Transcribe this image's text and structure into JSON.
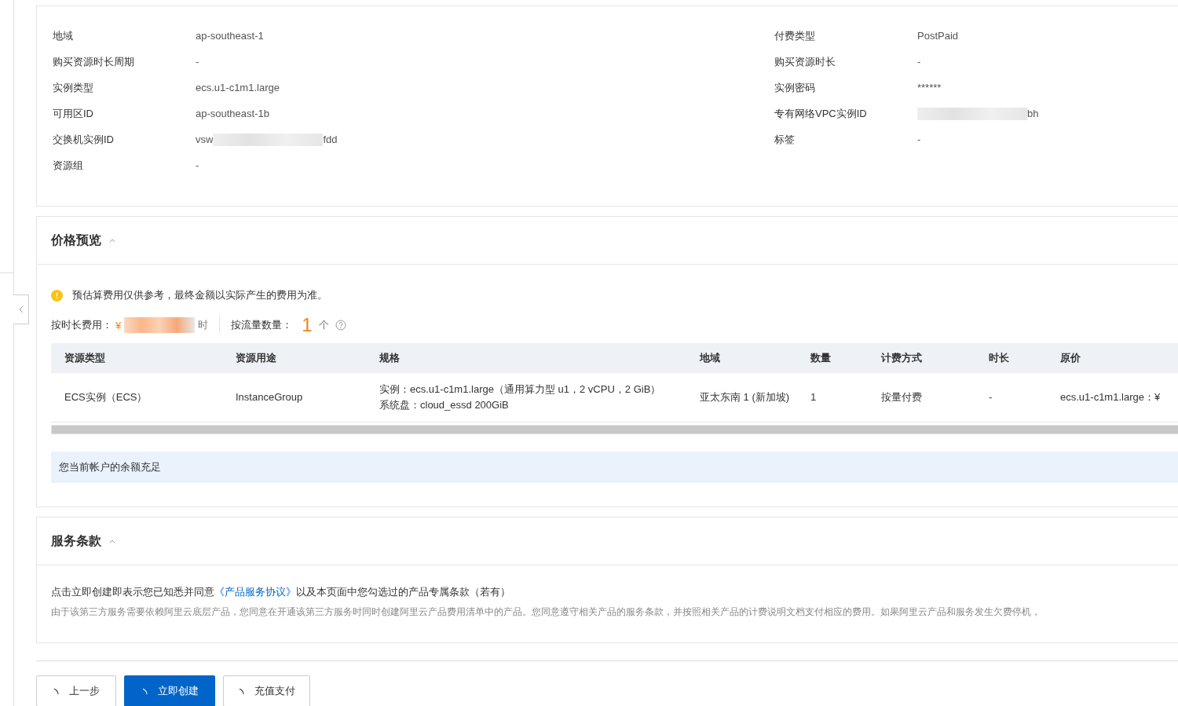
{
  "details": {
    "left": [
      {
        "label": "地域",
        "value": "ap-southeast-1"
      },
      {
        "label": "购买资源时长周期",
        "value": "-"
      },
      {
        "label": "实例类型",
        "value": "ecs.u1-c1m1.large"
      },
      {
        "label": "可用区ID",
        "value": "ap-southeast-1b"
      },
      {
        "label": "交换机实例ID",
        "value_start": "vsw",
        "value": "fdd",
        "redacted": true
      },
      {
        "label": "资源组",
        "value": "-"
      }
    ],
    "right": [
      {
        "label": "付费类型",
        "value": "PostPaid"
      },
      {
        "label": "购买资源时长",
        "value": "-"
      },
      {
        "label": "实例密码",
        "value": "******"
      },
      {
        "label": "专有网络VPC实例ID",
        "value": "bh",
        "redacted": true
      },
      {
        "label": "标签",
        "value": "-"
      }
    ]
  },
  "price_preview": {
    "title": "价格预览",
    "expanded": true,
    "notice": "预估算费用仅供参考，最终金额以实际产生的费用为准。",
    "hourly_fee": {
      "label": "按时长费用：",
      "prefix": "¥",
      "suffix": "时",
      "redacted": true
    },
    "traffic_count": {
      "label": "按流量数量：",
      "value": "1",
      "unit": "个"
    },
    "table": {
      "columns": [
        "资源类型",
        "资源用途",
        "规格",
        "地域",
        "数量",
        "计费方式",
        "时长",
        "原价"
      ],
      "rows": [
        [
          "ECS实例（ECS）",
          "InstanceGroup",
          [
            "实例：ecs.u1-c1m1.large（通用算力型 u1，2 vCPU，2 GiB）",
            "系统盘：cloud_essd 200GiB"
          ],
          "亚太东南 1 (新加坡)",
          "1",
          "按量付费",
          "-",
          "ecs.u1-c1m1.large：¥"
        ]
      ]
    },
    "balance_notice": "您当前帐户的余额充足"
  },
  "terms": {
    "title": "服务条款",
    "expanded": true,
    "line_before": "点击立即创建即表示您已知悉并同意",
    "link": "《产品服务协议》",
    "line_after": "以及本页面中您勾选过的产品专属条款（若有）",
    "note": "由于该第三方服务需要依赖阿里云底层产品，您同意在开通该第三方服务时同时创建阿里云产品费用清单中的产品。您同意遵守相关产品的服务条款，并按照相关产品的计费说明文档支付相应的费用。如果阿里云产品和服务发生欠费停机，"
  },
  "buttons": [
    {
      "label": "上一步",
      "primary": false,
      "loading": true
    },
    {
      "label": "立即创建",
      "primary": true,
      "loading": true
    },
    {
      "label": "充值支付",
      "primary": false,
      "loading": true
    }
  ]
}
